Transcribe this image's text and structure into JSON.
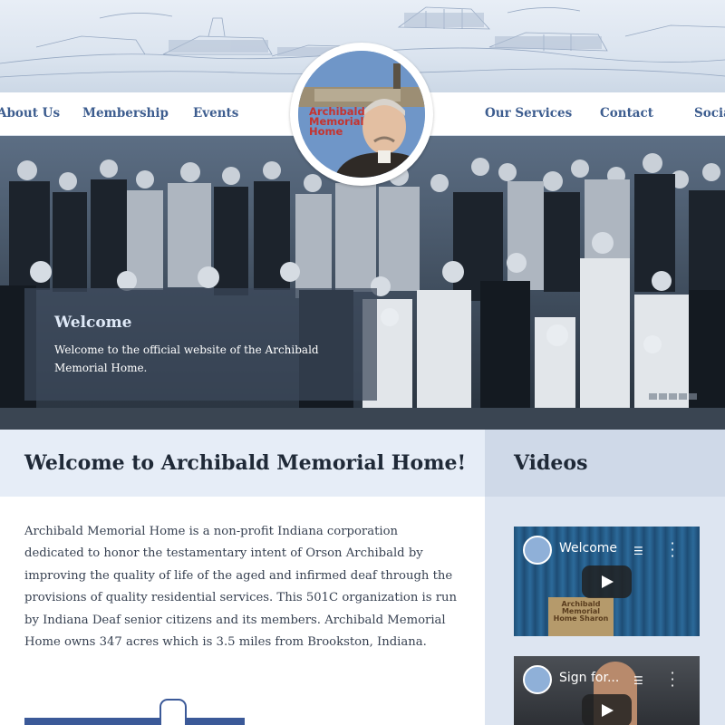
{
  "nav": {
    "items": [
      "About Us",
      "Membership",
      "Events",
      "Our Services",
      "Contact",
      "Social"
    ]
  },
  "logo": {
    "line1": "Archibald",
    "line2": "Memorial",
    "line3": "Home"
  },
  "hero": {
    "caption_title": "Welcome",
    "caption_text": "Welcome to the official website of the Archibald Memorial Home.",
    "slide_count": 5,
    "active_slide": 5
  },
  "main": {
    "title": "Welcome to Archibald Memorial Home!",
    "body": "Archibald Memorial Home is a non-profit Indiana corporation dedicated to honor the testamentary intent of Orson Archibald by improving the quality of life of the aged and infirmed deaf through the provisions of quality residential services. This 501C organization is run by Indiana Deaf senior citizens and its members. Archibald Memorial Home owns 347 acres which is 3.5 miles from Brookston, Indiana."
  },
  "sidebar": {
    "title": "Videos",
    "videos": [
      {
        "title": "Welcome",
        "podium_text": "Archibald Memorial Home Sharon"
      },
      {
        "title": "Sign for..."
      }
    ]
  },
  "colors": {
    "nav_text": "#3d5d8f",
    "heading_bg": "#e6edf7",
    "sidebar_bg": "#dde5f1",
    "logo_text": "#c5332e",
    "facebook": "#3b5998"
  }
}
